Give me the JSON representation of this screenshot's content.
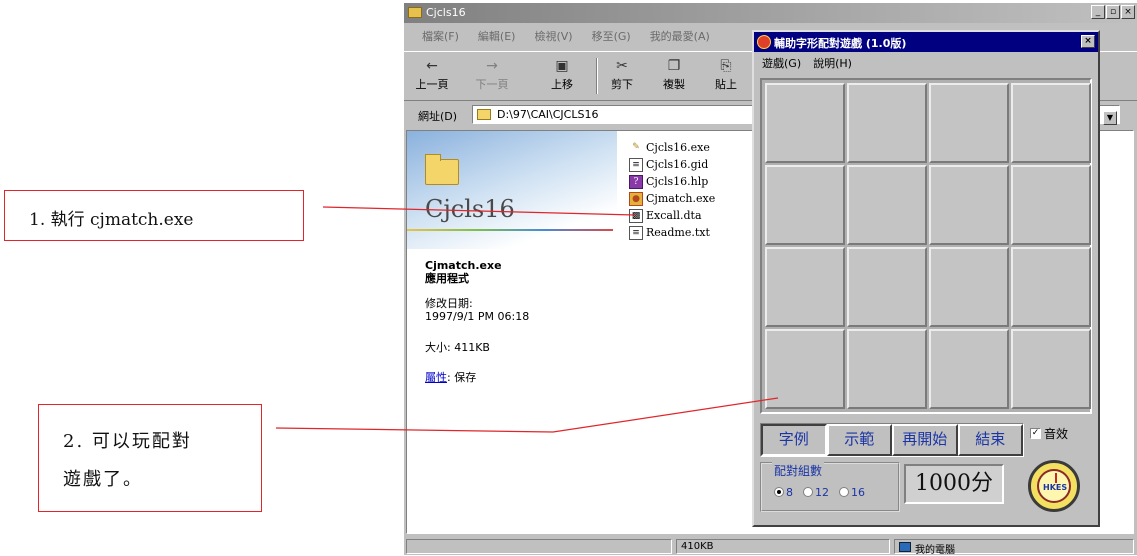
{
  "callouts": {
    "step1": "1. 執行 cjmatch.exe",
    "step2_line1": "2. 可以玩配對",
    "step2_line2": "遊戲了。"
  },
  "explorer": {
    "title": "Cjcls16",
    "window_buttons": [
      "_",
      "▫",
      "×"
    ],
    "menu": [
      "檔案(F)",
      "編輯(E)",
      "檢視(V)",
      "移至(G)",
      "我的最愛(A)"
    ],
    "toolbar": [
      {
        "label": "上一頁",
        "icon": "back-icon"
      },
      {
        "label": "下一頁",
        "icon": "forward-icon"
      },
      {
        "label": "上移",
        "icon": "up-folder-icon"
      },
      {
        "label": "剪下",
        "icon": "cut-icon"
      },
      {
        "label": "複製",
        "icon": "copy-icon"
      },
      {
        "label": "貼上",
        "icon": "paste-icon"
      }
    ],
    "address_label": "網址(D)",
    "address_value": "D:\\97\\CAI\\CJCLS16",
    "folder_title": "Cjcls16",
    "files": [
      {
        "name": "Cjcls16.exe",
        "icon": "program-icon"
      },
      {
        "name": "Cjcls16.gid",
        "icon": "file-icon"
      },
      {
        "name": "Cjcls16.hlp",
        "icon": "help-icon"
      },
      {
        "name": "Cjmatch.exe",
        "icon": "cjmatch-icon"
      },
      {
        "name": "Excall.dta",
        "icon": "file-icon"
      },
      {
        "name": "Readme.txt",
        "icon": "text-file-icon"
      }
    ],
    "info": {
      "selected_name": "Cjmatch.exe",
      "selected_type": "應用程式",
      "modified_label": "修改日期:",
      "modified_value": "1997/9/1 PM 06:18",
      "size": "大小: 411KB",
      "attr_label": "屬性",
      "attr_value": ": 保存"
    },
    "status": {
      "size": "410KB",
      "location": "我的電腦"
    }
  },
  "game": {
    "title": "輔助字形配對遊戲 (1.0版)",
    "close": "×",
    "menu": [
      "遊戲(G)",
      "說明(H)"
    ],
    "buttons": [
      "字例",
      "示範",
      "再開始",
      "結束"
    ],
    "sound_label": "音效",
    "sound_checked": true,
    "pairs_label": "配對組數",
    "pairs_options": [
      "8",
      "12",
      "16"
    ],
    "pairs_selected": "8",
    "score": "1000分",
    "logo_text": "HKES"
  },
  "colors": {
    "callout_border": "#e0262a",
    "game_title_bg": "#000080",
    "button_text": "#1b35a5"
  }
}
